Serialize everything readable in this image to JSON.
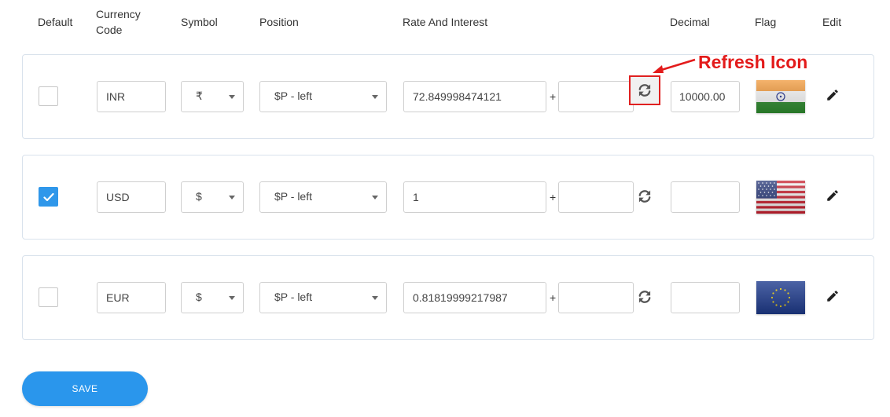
{
  "headers": {
    "default": "Default",
    "currency_code_line1": "Currency",
    "currency_code_line2": "Code",
    "symbol": "Symbol",
    "position": "Position",
    "rate_and_interest": "Rate And Interest",
    "decimal": "Decimal",
    "flag": "Flag",
    "edit": "Edit"
  },
  "rows": [
    {
      "default_checked": false,
      "currency_code": "INR",
      "symbol": "₹",
      "position": "$P - left",
      "rate": "72.849998474121",
      "plus": "+",
      "interest": "",
      "decimal": "10000.00",
      "flag": "india-flag"
    },
    {
      "default_checked": true,
      "currency_code": "USD",
      "symbol": "$",
      "position": "$P - left",
      "rate": "1",
      "plus": "+",
      "interest": "",
      "decimal": "",
      "flag": "usa-flag"
    },
    {
      "default_checked": false,
      "currency_code": "EUR",
      "symbol": "$",
      "position": "$P - left",
      "rate": "0.81819999217987",
      "plus": "+",
      "interest": "",
      "decimal": "",
      "flag": "eu-flag"
    }
  ],
  "annotation": {
    "label": "Refresh Icon",
    "color": "#e31b1b"
  },
  "save_button": "SAVE",
  "colors": {
    "accent": "#2a96ec",
    "checkbox_checked": "#2f97ea",
    "row_border": "#d9e2ec"
  }
}
